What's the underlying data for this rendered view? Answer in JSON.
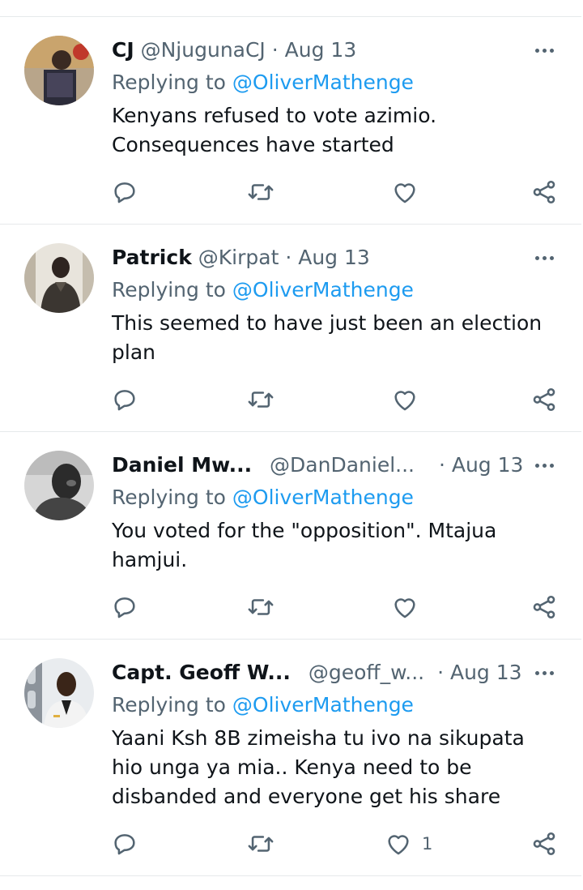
{
  "tweets": [
    {
      "name": "CJ",
      "handle": "@NjugunaCJ",
      "date": "· Aug 13",
      "replying_prefix": "Replying to",
      "replying_to": "@OliverMathenge",
      "text_lines": [
        "Kenyans refused to vote azimio.",
        "Consequences have started"
      ],
      "like_count": ""
    },
    {
      "name": "Patrick",
      "handle": "@Kirpat",
      "date": "· Aug 13",
      "replying_prefix": "Replying to",
      "replying_to": "@OliverMathenge",
      "text_lines": [
        "This seemed to have just been an election",
        "plan"
      ],
      "like_count": ""
    },
    {
      "name": "Daniel Mw...",
      "handle": "@DanDaniel...",
      "date": "· Aug 13",
      "replying_prefix": "Replying to",
      "replying_to": "@OliverMathenge",
      "text_lines": [
        "You voted for the \"opposition\". Mtajua",
        "hamjui."
      ],
      "like_count": ""
    },
    {
      "name": "Capt. Geoff W...",
      "handle": "@geoff_w...",
      "date": "· Aug 13",
      "replying_prefix": "Replying to",
      "replying_to": "@OliverMathenge",
      "text_lines": [
        "Yaani Ksh 8B zimeisha tu ivo na sikupata",
        "hio unga ya mia.. Kenya need to be",
        "disbanded and everyone get his share"
      ],
      "like_count": "1"
    }
  ],
  "icons": {
    "reply": "reply-icon",
    "retweet": "retweet-icon",
    "like": "heart-icon",
    "share": "share-icon",
    "more": "more-icon"
  },
  "colors": {
    "link": "#1d9bf0",
    "muted": "#536471",
    "text": "#0f1419",
    "divider": "#e6e9eb"
  }
}
